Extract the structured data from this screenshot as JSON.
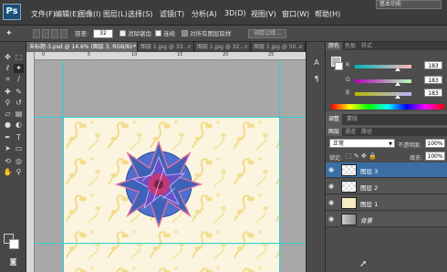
{
  "menubar": {
    "logo": "Ps",
    "items": [
      "文件(F)",
      "编辑(E)",
      "图像(I)",
      "图层(L)",
      "选择(S)",
      "滤镜(T)",
      "分析(A)",
      "3D(D)",
      "视图(V)",
      "窗口(W)",
      "帮助(H)"
    ],
    "workspace": "基本功能"
  },
  "options": {
    "tolerance_label": "容差:",
    "tolerance_value": "32",
    "antialias_label": "消除锯齿",
    "contiguous_label": "连续",
    "all_layers_label": "对所有图层取样",
    "refine_edge_label": "调整边缘..."
  },
  "tabs": [
    {
      "label": "未标题-3.psd @ 14.6% (图层 3, RGB/8) *",
      "active": true
    },
    {
      "label": "图层 1.jpg @ 33...",
      "active": false
    },
    {
      "label": "图层 1.jpg @ 32...",
      "active": false
    },
    {
      "label": "图层 1.jpg @ 50...",
      "active": false
    }
  ],
  "color_panel": {
    "tabs": [
      "颜色",
      "色板",
      "样式"
    ],
    "r_label": "R",
    "g_label": "G",
    "b_label": "B",
    "r_value": "183",
    "g_value": "183",
    "b_value": "183"
  },
  "adjust_panel": {
    "tabs": [
      "调整",
      "蒙版"
    ]
  },
  "layers_panel": {
    "tabs": [
      "图层",
      "通道",
      "路径"
    ],
    "blend_mode": "正常",
    "opacity_label": "不透明度:",
    "opacity_value": "100%",
    "lock_label": "锁定:",
    "fill_label": "填充:",
    "fill_value": "100%",
    "layers": [
      {
        "name": "图层 3",
        "selected": true
      },
      {
        "name": "图层 2",
        "selected": false
      },
      {
        "name": "图层 1",
        "selected": false
      },
      {
        "name": "背景",
        "selected": false
      }
    ]
  },
  "colors": {
    "selected_layer": "#3a6ea5",
    "guide": "#2fd0d0",
    "canvas_bg": "#fbf4df",
    "star_fill": "#3d62b8",
    "star_edge": "#e070a0",
    "circle_fill": "#4c6fd0",
    "flower_center": "#c03a7a",
    "floral_pattern": "#f0dc8a"
  }
}
